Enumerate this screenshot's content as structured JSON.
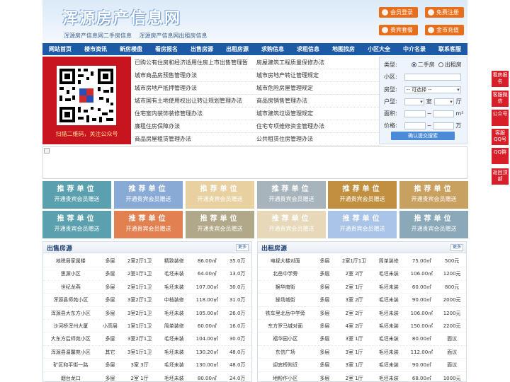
{
  "header": {
    "title": "浑源房产信息网",
    "sub_links": [
      "浑源房产信息网二手房信息",
      "浑源房产信息网出租房信息"
    ],
    "buttons": [
      "会员登录",
      "免费注册",
      "贵宾套餐",
      "金币充值"
    ]
  },
  "nav": [
    "网站首页",
    "楼市资讯",
    "新房楼盘",
    "看房报名",
    "出售房源",
    "出租房源",
    "求购信息",
    "求租信息",
    "地图找房",
    "小区大全",
    "中介名录",
    "联系客服"
  ],
  "qr": {
    "caption": "扫描二维码，关注公众号"
  },
  "news_left": [
    "已购公有住房和经济适用住房上市出售管理暂",
    "城市商品房预售管理办法",
    "城市房地产抵押管理办法",
    "城市国有土地使用权出让转让规划管理办法",
    "住宅室内装饰装修管理办法",
    "廉租住房保障办法",
    "商品房屋租赁管理办法"
  ],
  "news_right": [
    "房屋建筑工程质量保修办法",
    "城市房地产转让管理规定",
    "城市危险房屋管理规定",
    "商品房销售管理办法",
    "城市建筑垃圾管理规定",
    "住宅专项维修资金管理办法",
    "公共租赁住房管理办法"
  ],
  "search": {
    "type_label": "类型:",
    "type_options": [
      "二手房",
      "出租房"
    ],
    "community_label": "小区:",
    "house_type_label": "房型:",
    "house_type_value": "-- 可选择 --",
    "layout_label": "户型:",
    "room_unit": "室",
    "hall_unit": "厅",
    "area_label": "面积:",
    "price_label": "价格:",
    "range_sep": "~",
    "area_unit": "m²",
    "price_unit": "万",
    "submit": "确认提交搜索"
  },
  "tiles": {
    "line1": "推荐单位",
    "line2": "开通贵宾会员赠送",
    "colors": [
      "#5aa0ae",
      "#8aaad6",
      "#e8d0a0",
      "#a8b4bc",
      "#c09040",
      "#c8a060",
      "#5aa0ae",
      "#e28050",
      "#b0a888",
      "#e6d8b8",
      "#aac4e8",
      "#8aa8b8"
    ]
  },
  "sale": {
    "title": "出售房源",
    "more": "更多",
    "rows": [
      [
        "地税局家属楼",
        "多层",
        "2室2厅1卫",
        "精致装修",
        "86.00㎡",
        "35.0万"
      ],
      [
        "思源小区",
        "多层",
        "2室1厅1卫",
        "毛坯未装",
        "64.00㎡",
        "13.0万"
      ],
      [
        "世纪龙燕",
        "多层",
        "2室1厅1卫",
        "毛坯未装",
        "107.00㎡",
        "30.0万"
      ],
      [
        "浑源县师苑小区",
        "多层",
        "3室2厅1卫",
        "中档装修",
        "118.00㎡",
        "31.0万"
      ],
      [
        "浑源县大东方小区",
        "多层",
        "3室2厅1卫",
        "毛坯未装",
        "105.00㎡",
        "26.0万"
      ],
      [
        "沙河桥浑州大厦",
        "小高层",
        "1室1厅1卫",
        "简单装修",
        "60.00㎡",
        "16.0万"
      ],
      [
        "大东方后师苑小区",
        "多层",
        "3室2厅1卫",
        "毛坯未装",
        "104.00㎡",
        "30.0万"
      ],
      [
        "浑源县温馨苑小区",
        "其它",
        "3室1厅1卫",
        "毛坯未装",
        "130.20㎡",
        "48.0万"
      ],
      [
        "矿区和平街一路",
        "多层",
        "3室 3厅",
        "毛坯未装",
        "130.00㎡",
        "48.0万"
      ],
      [
        "烟台龙口",
        "多层",
        "2室 1厅",
        "毛坯未装",
        "80.00㎡",
        "24.0万"
      ]
    ]
  },
  "rent": {
    "title": "出租房源",
    "more": "更多",
    "rows": [
      [
        "电视大楼对面",
        "多层",
        "2室1厅1卫",
        "简单装修",
        "75.00㎡",
        "500元"
      ],
      [
        "北岳中学旁",
        "多层",
        "2室 2厅",
        "毛坯未装",
        "106.00㎡",
        "1200元"
      ],
      [
        "据华南街",
        "多层",
        "2室 1厅",
        "毛坯未装",
        "60.00㎡",
        "800元"
      ],
      [
        "操场城街",
        "多层",
        "3室 2厅",
        "毛坯未装",
        "90.00㎡",
        "2000元"
      ],
      [
        "铁车里北岳中学旁",
        "多层",
        "2室 2厅",
        "毛坯未装",
        "106.00㎡",
        "1200元"
      ],
      [
        "东方罗马城对面",
        "多层",
        "4室 2厅",
        "毛坯未装",
        "150.00㎡",
        "2200元"
      ],
      [
        "福华园小区",
        "多层",
        "3室 1厅",
        "毛坯未装",
        "80.00㎡",
        "面议"
      ],
      [
        "东信广场",
        "多层",
        "3室 1厅",
        "毛坯未装",
        "112.00㎡",
        "面议"
      ],
      [
        "迎宾桥附近",
        "多层",
        "3室 1厅",
        "毛坯未装",
        "90.00㎡",
        "面议"
      ],
      [
        "地粉作小区",
        "多层",
        "2室 1厅",
        "毛坯未装",
        "68.00㎡",
        "1000元"
      ]
    ]
  },
  "side": [
    "看房报名",
    "客服微信",
    "公众号",
    "客服QQ号",
    "QQ群",
    "返回顶部"
  ]
}
